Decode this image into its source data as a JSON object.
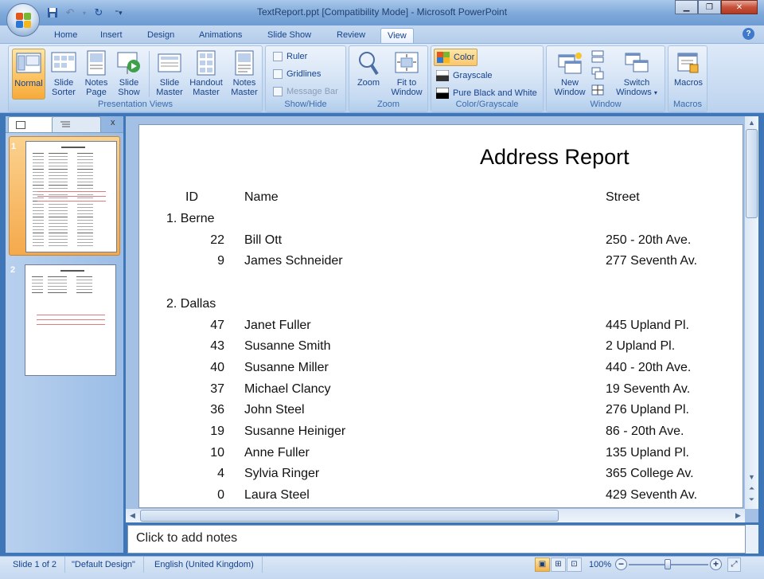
{
  "window": {
    "title": "TextReport.ppt [Compatibility Mode] - Microsoft PowerPoint"
  },
  "qat": {
    "icons": [
      "save-icon",
      "undo-icon",
      "redo-icon",
      "customize-icon"
    ]
  },
  "tabs": [
    "Home",
    "Insert",
    "Design",
    "Animations",
    "Slide Show",
    "Review",
    "View"
  ],
  "active_tab": "View",
  "ribbon": {
    "presentation_views": {
      "label": "Presentation Views",
      "buttons": [
        {
          "line1": "Normal",
          "line2": ""
        },
        {
          "line1": "Slide",
          "line2": "Sorter"
        },
        {
          "line1": "Notes",
          "line2": "Page"
        },
        {
          "line1": "Slide",
          "line2": "Show"
        },
        {
          "line1": "Slide",
          "line2": "Master"
        },
        {
          "line1": "Handout",
          "line2": "Master"
        },
        {
          "line1": "Notes",
          "line2": "Master"
        }
      ]
    },
    "show_hide": {
      "label": "Show/Hide",
      "ruler": "Ruler",
      "gridlines": "Gridlines",
      "message_bar": "Message Bar"
    },
    "zoom": {
      "label": "Zoom",
      "zoom": "Zoom",
      "fit_line1": "Fit to",
      "fit_line2": "Window"
    },
    "color_grayscale": {
      "label": "Color/Grayscale",
      "color": "Color",
      "grayscale": "Grayscale",
      "pure_bw": "Pure Black and White"
    },
    "window": {
      "label": "Window",
      "new_line1": "New",
      "new_line2": "Window",
      "switch_line1": "Switch",
      "switch_line2": "Windows"
    },
    "macros": {
      "label": "Macros",
      "macros": "Macros"
    }
  },
  "slides_pane": {
    "numbers": [
      "1",
      "2"
    ]
  },
  "slide": {
    "title": "Address Report",
    "headers": {
      "id": "ID",
      "name": "Name",
      "street": "Street"
    },
    "groups": [
      {
        "label": "1. Berne",
        "rows": [
          {
            "id": "22",
            "name": "Bill Ott",
            "street": "250 - 20th Ave."
          },
          {
            "id": "9",
            "name": "James Schneider",
            "street": "277 Seventh Av."
          }
        ]
      },
      {
        "label": "2. Dallas",
        "rows": [
          {
            "id": "47",
            "name": "Janet Fuller",
            "street": "445 Upland Pl."
          },
          {
            "id": "43",
            "name": "Susanne Smith",
            "street": "2 Upland Pl."
          },
          {
            "id": "40",
            "name": "Susanne Miller",
            "street": "440 - 20th Ave."
          },
          {
            "id": "37",
            "name": "Michael Clancy",
            "street": "19 Seventh Av."
          },
          {
            "id": "36",
            "name": "John Steel",
            "street": "276 Upland Pl."
          },
          {
            "id": "19",
            "name": "Susanne Heiniger",
            "street": "86 - 20th Ave."
          },
          {
            "id": "10",
            "name": "Anne Fuller",
            "street": "135 Upland Pl."
          },
          {
            "id": "4",
            "name": "Sylvia Ringer",
            "street": "365 College Av."
          },
          {
            "id": "0",
            "name": "Laura Steel",
            "street": "429 Seventh Av."
          }
        ]
      }
    ]
  },
  "notes": {
    "placeholder": "Click to add notes"
  },
  "status": {
    "slide": "Slide 1 of 2",
    "design": "\"Default Design\"",
    "language": "English (United Kingdom)",
    "zoom": "100%"
  },
  "colors": {
    "accent": "#15428b",
    "ribbon": "#c8dbf2",
    "active": "#f6aa3a"
  }
}
